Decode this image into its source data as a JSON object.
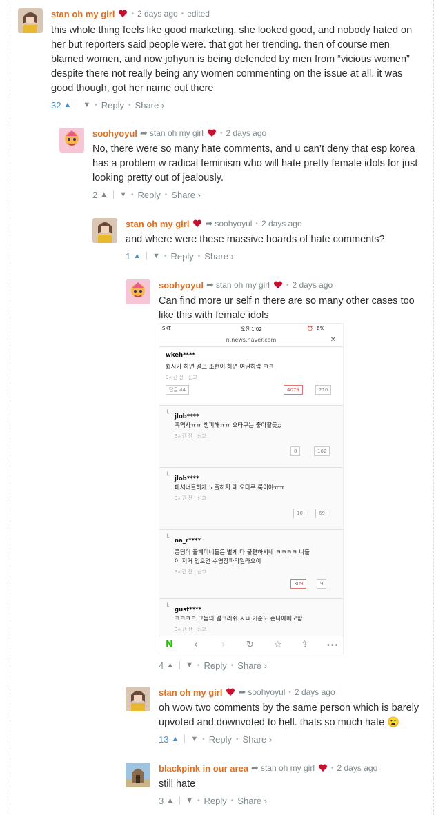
{
  "comments": [
    {
      "author": "stan oh my girl",
      "time": "2 days ago",
      "edited": "edited",
      "text": "this whole thing feels like good marketing. she looked good, and nobody hated on her but reporters said people were. that got her trending. then of course men blamed women, and now johyun is being defended by men from “vicious women” despite there not really being any women commenting on the issue at all. it was good though, got her name out there",
      "votes": "32"
    },
    {
      "author": "soohyoyul",
      "reply_to": "stan oh my girl",
      "time": "2 days ago",
      "text": "No, there were so many hate comments, and u can’t deny that esp korea has a problem w radical feminism who will hate pretty female idols for just looking pretty out of jealously.",
      "votes": "2"
    },
    {
      "author": "stan oh my girl",
      "reply_to": "soohyoyul",
      "time": "2 days ago",
      "text": "and where were these massive hoards of hate comments?",
      "votes": "1"
    },
    {
      "author": "soohyoyul",
      "reply_to": "stan oh my girl",
      "time": "2 days ago",
      "text": "Can find more ur self n there are so many other cases too like this with female idols",
      "votes": "4"
    },
    {
      "author": "stan oh my girl",
      "reply_to": "soohyoyul",
      "time": "2 days ago",
      "text": "oh wow two comments by the same person which is barely upvoted and downvoted to hell. thats so much hate 😮",
      "votes": "13"
    },
    {
      "author": "blackpink in our area",
      "reply_to": "stan oh my girl",
      "time": "2 days ago",
      "text": "still hate",
      "votes": "3"
    }
  ],
  "actions": {
    "reply": "Reply",
    "share": "Share ›"
  },
  "screenshot": {
    "carrier": "SKT",
    "clock": "오전 1:02",
    "battery": "6%",
    "url": "n.news.naver.com",
    "items": [
      {
        "user": "wkeh****",
        "text": "화사가 하면 걸크 조현이 하면 여권하락 ㅋㅋ",
        "time": "3시간 전",
        "report": "신고",
        "replies": "답글 44",
        "up": "4079",
        "down": "210"
      },
      {
        "user": "jlob****",
        "text": "흑역사ㅠㅠ 챙피해ㅠㅠ 오타쿠는 좋아할듯;;",
        "time": "3시간 전",
        "report": "신고",
        "up": "8",
        "down": "102"
      },
      {
        "user": "jlob****",
        "text": "패셔너블하게 노출하지 왜 오타쿠 룩이야ㅠㅠ",
        "time": "3시간 전",
        "report": "신고",
        "up": "10",
        "down": "69"
      },
      {
        "user": "na_r****",
        "text": "콩팅이 꼴페미네들은 별게 다 불편하시네 ㅋㅋㅋㅋ 니들\n이 저거 입으면 수영장파티일라오이",
        "time": "3시간 전",
        "report": "신고",
        "up": "309",
        "down": "9"
      },
      {
        "user": "gust****",
        "text": "ㅋㅋㅋㅋ,그놈의 걸크러쉬 ㅅㅂ 기준도 존나애매모함",
        "time": "3시간 전",
        "report": "신고"
      }
    ]
  }
}
